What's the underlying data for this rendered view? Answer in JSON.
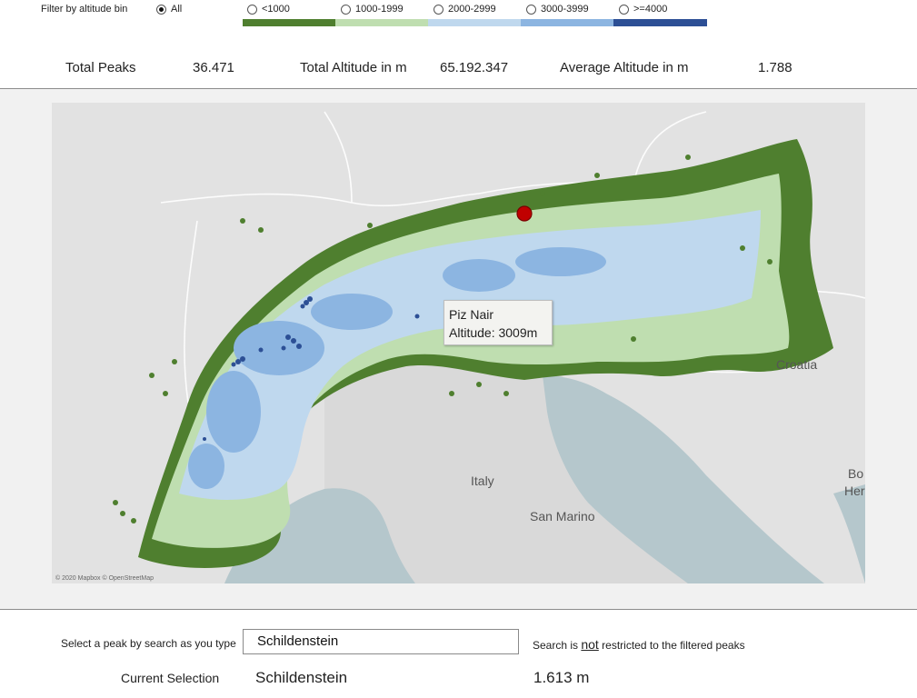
{
  "filter": {
    "label": "Filter by altitude bin",
    "options": [
      {
        "label": "All",
        "selected": true
      },
      {
        "label": "<1000",
        "selected": false,
        "color": "#4f7f2f"
      },
      {
        "label": "1000-1999",
        "selected": false,
        "color": "#bfdeb0"
      },
      {
        "label": "2000-2999",
        "selected": false,
        "color": "#bfd8ee"
      },
      {
        "label": "3000-3999",
        "selected": false,
        "color": "#8cb5e1"
      },
      {
        "label": ">=4000",
        "selected": false,
        "color": "#2c4f95"
      }
    ]
  },
  "kpis": {
    "total_peaks_label": "Total Peaks",
    "total_peaks_value": "36.471",
    "total_altitude_label": "Total Altitude in m",
    "total_altitude_value": "65.192.347",
    "avg_altitude_label": "Average Altitude in m",
    "avg_altitude_value": "1.788"
  },
  "map": {
    "tooltip_name": "Piz Nair",
    "tooltip_altitude": "Altitude: 3009m",
    "place_labels": [
      "Croatia",
      "Italy",
      "San Marino",
      "Bo",
      "Her"
    ],
    "credit": "© 2020 Mapbox © OpenStreetMap",
    "selected_marker_color": "#c00000",
    "colors": {
      "water": "#b5c7cc",
      "land_other": "#e2e2e2",
      "land_italy": "#d9d9d9",
      "bin_lt1000": "#4f7f2f",
      "bin_1000": "#bfdeb0",
      "bin_2000": "#bfd8ee",
      "bin_3000": "#8cb5e1",
      "bin_4000": "#2c4f95"
    }
  },
  "search": {
    "label": "Select a peak by search as you type",
    "value": "Schildenstein",
    "note_prefix": "Search is ",
    "note_emph": "not",
    "note_suffix": " restricted to the filtered peaks"
  },
  "selection": {
    "label": "Current Selection",
    "name": "Schildenstein",
    "altitude": "1.613 m"
  }
}
